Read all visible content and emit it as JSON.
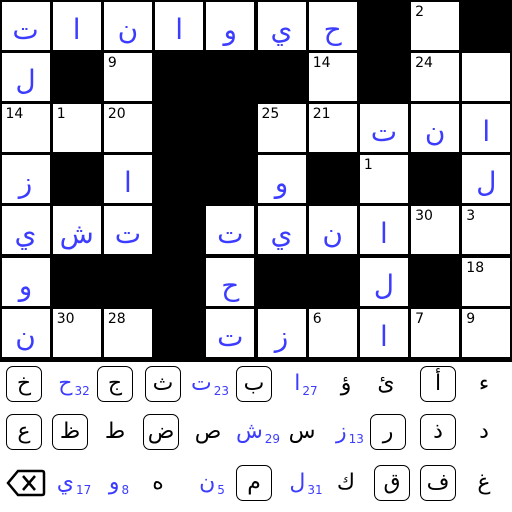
{
  "grid": {
    "cells": [
      {
        "r": 0,
        "c": 0,
        "num": "",
        "letter": "ت"
      },
      {
        "r": 0,
        "c": 1,
        "num": "",
        "letter": "ا"
      },
      {
        "r": 0,
        "c": 2,
        "num": "",
        "letter": "ن"
      },
      {
        "r": 0,
        "c": 3,
        "num": "",
        "letter": "ا"
      },
      {
        "r": 0,
        "c": 4,
        "num": "",
        "letter": "و"
      },
      {
        "r": 0,
        "c": 5,
        "num": "",
        "letter": "ي"
      },
      {
        "r": 0,
        "c": 6,
        "num": "",
        "letter": "ح"
      },
      {
        "r": 0,
        "c": 8,
        "num": "2",
        "letter": ""
      },
      {
        "r": 1,
        "c": 0,
        "num": "",
        "letter": "ل"
      },
      {
        "r": 1,
        "c": 2,
        "num": "9",
        "letter": ""
      },
      {
        "r": 1,
        "c": 6,
        "num": "14",
        "letter": ""
      },
      {
        "r": 1,
        "c": 8,
        "num": "24",
        "letter": ""
      },
      {
        "r": 1,
        "c": 9,
        "num": "",
        "letter": ""
      },
      {
        "r": 2,
        "c": 0,
        "num": "14",
        "letter": ""
      },
      {
        "r": 2,
        "c": 1,
        "num": "1",
        "letter": ""
      },
      {
        "r": 2,
        "c": 2,
        "num": "20",
        "letter": ""
      },
      {
        "r": 2,
        "c": 5,
        "num": "25",
        "letter": ""
      },
      {
        "r": 2,
        "c": 6,
        "num": "21",
        "letter": ""
      },
      {
        "r": 2,
        "c": 7,
        "num": "",
        "letter": "ت"
      },
      {
        "r": 2,
        "c": 8,
        "num": "",
        "letter": "ن"
      },
      {
        "r": 2,
        "c": 9,
        "num": "",
        "letter": "ا"
      },
      {
        "r": 3,
        "c": 0,
        "num": "",
        "letter": "ز"
      },
      {
        "r": 3,
        "c": 2,
        "num": "",
        "letter": "ا"
      },
      {
        "r": 3,
        "c": 5,
        "num": "",
        "letter": "و"
      },
      {
        "r": 3,
        "c": 7,
        "num": "1",
        "letter": ""
      },
      {
        "r": 3,
        "c": 9,
        "num": "",
        "letter": "ل"
      },
      {
        "r": 4,
        "c": 0,
        "num": "",
        "letter": "ي"
      },
      {
        "r": 4,
        "c": 1,
        "num": "",
        "letter": "ش"
      },
      {
        "r": 4,
        "c": 2,
        "num": "",
        "letter": "ت"
      },
      {
        "r": 4,
        "c": 4,
        "num": "",
        "letter": "ت"
      },
      {
        "r": 4,
        "c": 5,
        "num": "",
        "letter": "ي"
      },
      {
        "r": 4,
        "c": 6,
        "num": "",
        "letter": "ن"
      },
      {
        "r": 4,
        "c": 7,
        "num": "",
        "letter": "ا"
      },
      {
        "r": 4,
        "c": 8,
        "num": "30",
        "letter": ""
      },
      {
        "r": 4,
        "c": 9,
        "num": "3",
        "letter": ""
      },
      {
        "r": 5,
        "c": 0,
        "num": "",
        "letter": "و"
      },
      {
        "r": 5,
        "c": 4,
        "num": "",
        "letter": "ح"
      },
      {
        "r": 5,
        "c": 7,
        "num": "",
        "letter": "ل"
      },
      {
        "r": 5,
        "c": 9,
        "num": "18",
        "letter": ""
      },
      {
        "r": 6,
        "c": 0,
        "num": "",
        "letter": "ن"
      },
      {
        "r": 6,
        "c": 1,
        "num": "30",
        "letter": ""
      },
      {
        "r": 6,
        "c": 2,
        "num": "28",
        "letter": ""
      },
      {
        "r": 6,
        "c": 4,
        "num": "",
        "letter": "ت"
      },
      {
        "r": 6,
        "c": 5,
        "num": "",
        "letter": "ز"
      },
      {
        "r": 6,
        "c": 6,
        "num": "6",
        "letter": ""
      },
      {
        "r": 6,
        "c": 7,
        "num": "",
        "letter": "ا"
      },
      {
        "r": 6,
        "c": 8,
        "num": "7",
        "letter": ""
      },
      {
        "r": 6,
        "c": 9,
        "num": "9",
        "letter": ""
      }
    ]
  },
  "keyboard": {
    "keys": [
      {
        "char": "خ",
        "count": "",
        "boxed": true,
        "color": "black"
      },
      {
        "char": "ح",
        "count": "32",
        "boxed": false,
        "color": "blue"
      },
      {
        "char": "ج",
        "count": "",
        "boxed": true,
        "color": "black"
      },
      {
        "char": "ث",
        "count": "",
        "boxed": true,
        "color": "black"
      },
      {
        "char": "ت",
        "count": "23",
        "boxed": false,
        "color": "blue"
      },
      {
        "char": "ب",
        "count": "",
        "boxed": true,
        "color": "black"
      },
      {
        "char": "ا",
        "count": "27",
        "boxed": false,
        "color": "blue"
      },
      {
        "char": "ؤ",
        "count": "",
        "boxed": false,
        "color": "black"
      },
      {
        "char": "ئ",
        "count": "",
        "boxed": false,
        "color": "black"
      },
      {
        "char": "أ",
        "count": "",
        "boxed": true,
        "color": "black"
      },
      {
        "char": "ء",
        "count": "",
        "boxed": false,
        "color": "black"
      },
      {
        "char": "ع",
        "count": "",
        "boxed": true,
        "color": "black"
      },
      {
        "char": "ظ",
        "count": "",
        "boxed": true,
        "color": "black"
      },
      {
        "char": "ط",
        "count": "",
        "boxed": false,
        "color": "black"
      },
      {
        "char": "ض",
        "count": "",
        "boxed": true,
        "color": "black"
      },
      {
        "char": "ص",
        "count": "",
        "boxed": false,
        "color": "black"
      },
      {
        "char": "ش",
        "count": "29",
        "boxed": false,
        "color": "blue"
      },
      {
        "char": "س",
        "count": "",
        "boxed": false,
        "color": "black"
      },
      {
        "char": "ز",
        "count": "13",
        "boxed": false,
        "color": "blue"
      },
      {
        "char": "ر",
        "count": "",
        "boxed": true,
        "color": "black"
      },
      {
        "char": "ذ",
        "count": "",
        "boxed": true,
        "color": "black"
      },
      {
        "char": "د",
        "count": "",
        "boxed": false,
        "color": "black"
      },
      {
        "char": "ي",
        "count": "17",
        "boxed": false,
        "color": "blue"
      },
      {
        "char": "و",
        "count": "8",
        "boxed": false,
        "color": "blue"
      },
      {
        "char": "ه",
        "count": "",
        "boxed": false,
        "color": "black"
      },
      {
        "char": "ن",
        "count": "5",
        "boxed": false,
        "color": "blue"
      },
      {
        "char": "م",
        "count": "",
        "boxed": true,
        "color": "black"
      },
      {
        "char": "ل",
        "count": "31",
        "boxed": false,
        "color": "blue"
      },
      {
        "char": "ك",
        "count": "",
        "boxed": false,
        "color": "black"
      },
      {
        "char": "ق",
        "count": "",
        "boxed": true,
        "color": "black"
      },
      {
        "char": "ف",
        "count": "",
        "boxed": true,
        "color": "black"
      },
      {
        "char": "غ",
        "count": "",
        "boxed": false,
        "color": "black"
      }
    ],
    "backspace_icon": "backspace-icon"
  },
  "colors": {
    "filled_letter": "#3c3cff",
    "block": "#000000",
    "cell": "#ffffff"
  }
}
